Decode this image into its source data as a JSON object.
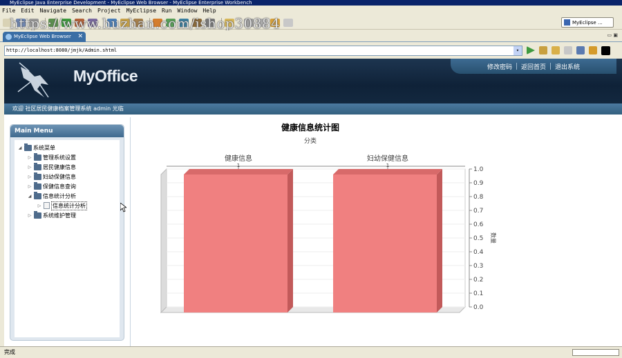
{
  "window": {
    "title": "MyEclipse Java Enterprise Development - MyEclipse Web Browser - MyEclipse Enterprise Workbench"
  },
  "menu": [
    "File",
    "Edit",
    "Navigate",
    "Search",
    "Project",
    "MyEclipse",
    "Run",
    "Window",
    "Help"
  ],
  "watermark": "https://www.huzhan.com/ishop30884",
  "perspective": {
    "label": "MyEclipse ..."
  },
  "tab": {
    "label": "MyEclipse Web Browser",
    "close": "✕"
  },
  "address": {
    "url": "http://localhost:8080/jmjk/Admin.shtml"
  },
  "app": {
    "logo": "MyOffice",
    "links": [
      "修改密码",
      "返回首页",
      "退出系统"
    ],
    "welcome": "欢迎 社区居民健康档案管理系统 admin 光临"
  },
  "sidebar": {
    "title": "Main Menu",
    "items": [
      {
        "label": "系统菜单",
        "level": 0,
        "expanded": true,
        "type": "folder"
      },
      {
        "label": "管理系统设置",
        "level": 1,
        "expanded": false,
        "type": "folder"
      },
      {
        "label": "居民健康信息",
        "level": 1,
        "expanded": false,
        "type": "folder"
      },
      {
        "label": "妇幼保健信息",
        "level": 1,
        "expanded": false,
        "type": "folder"
      },
      {
        "label": "保健信息查询",
        "level": 1,
        "expanded": false,
        "type": "folder"
      },
      {
        "label": "信息统计分析",
        "level": 1,
        "expanded": true,
        "type": "folder"
      },
      {
        "label": "信息统计分析",
        "level": 2,
        "expanded": false,
        "type": "file",
        "selected": true
      },
      {
        "label": "系统维护管理",
        "level": 1,
        "expanded": false,
        "type": "folder"
      }
    ]
  },
  "chart_data": {
    "type": "bar",
    "title": "健康信息统计图",
    "xlabel": "分类",
    "ylabel": "数量",
    "categories": [
      "健康信息",
      "妇幼保健信息"
    ],
    "values": [
      1,
      1
    ],
    "data_labels": [
      "1",
      "1"
    ],
    "ylim": [
      0,
      1.0
    ],
    "yticks": [
      "0.0",
      "0.1",
      "0.2",
      "0.3",
      "0.4",
      "0.5",
      "0.6",
      "0.7",
      "0.8",
      "0.9",
      "1.0"
    ],
    "bar_color": "#f08080",
    "x_axis_position": "top",
    "y_axis_position": "right"
  },
  "status": {
    "text": "完成"
  }
}
